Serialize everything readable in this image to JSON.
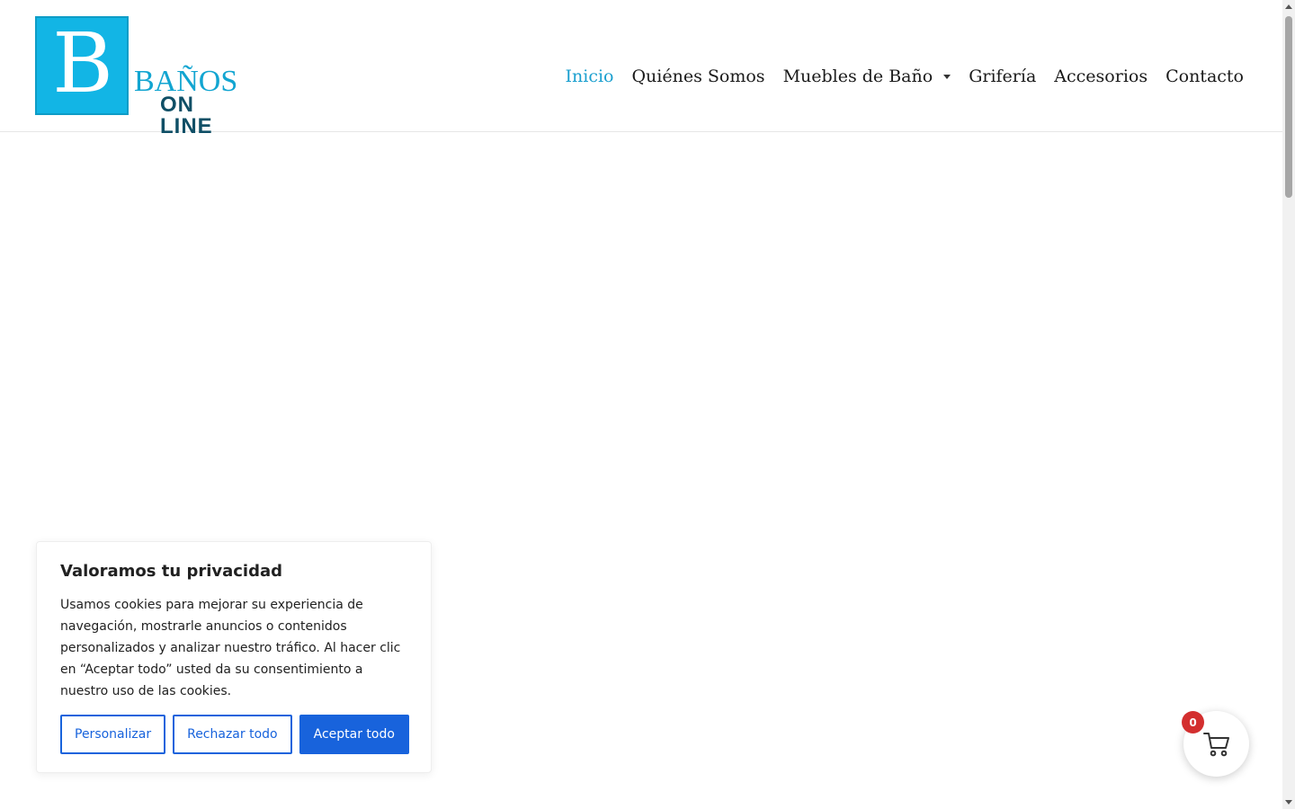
{
  "brand": {
    "logo_letter": "B",
    "name_top": "BAÑOS",
    "name_bottom": "ON LINE",
    "primary_color": "#12b5e5",
    "secondary_color": "#0f4f66"
  },
  "nav": {
    "items": [
      {
        "label": "Inicio",
        "active": true
      },
      {
        "label": "Quiénes Somos"
      },
      {
        "label": "Muebles de Baño",
        "has_dropdown": true
      },
      {
        "label": "Grifería"
      },
      {
        "label": "Accesorios"
      },
      {
        "label": "Contacto"
      }
    ],
    "active_color": "#1a9fcf"
  },
  "cookie_banner": {
    "title": "Valoramos tu privacidad",
    "body": "Usamos cookies para mejorar su experiencia de navegación, mostrarle anuncios o contenidos personalizados y analizar nuestro tráfico. Al hacer clic en “Aceptar todo” usted da su consentimiento a nuestro uso de las cookies.",
    "buttons": {
      "customize": "Personalizar",
      "reject": "Rechazar todo",
      "accept": "Aceptar todo"
    },
    "accent_color": "#1863dc"
  },
  "cart": {
    "count": "0",
    "icon": "shopping-cart-icon",
    "badge_color": "#d32f2f"
  }
}
